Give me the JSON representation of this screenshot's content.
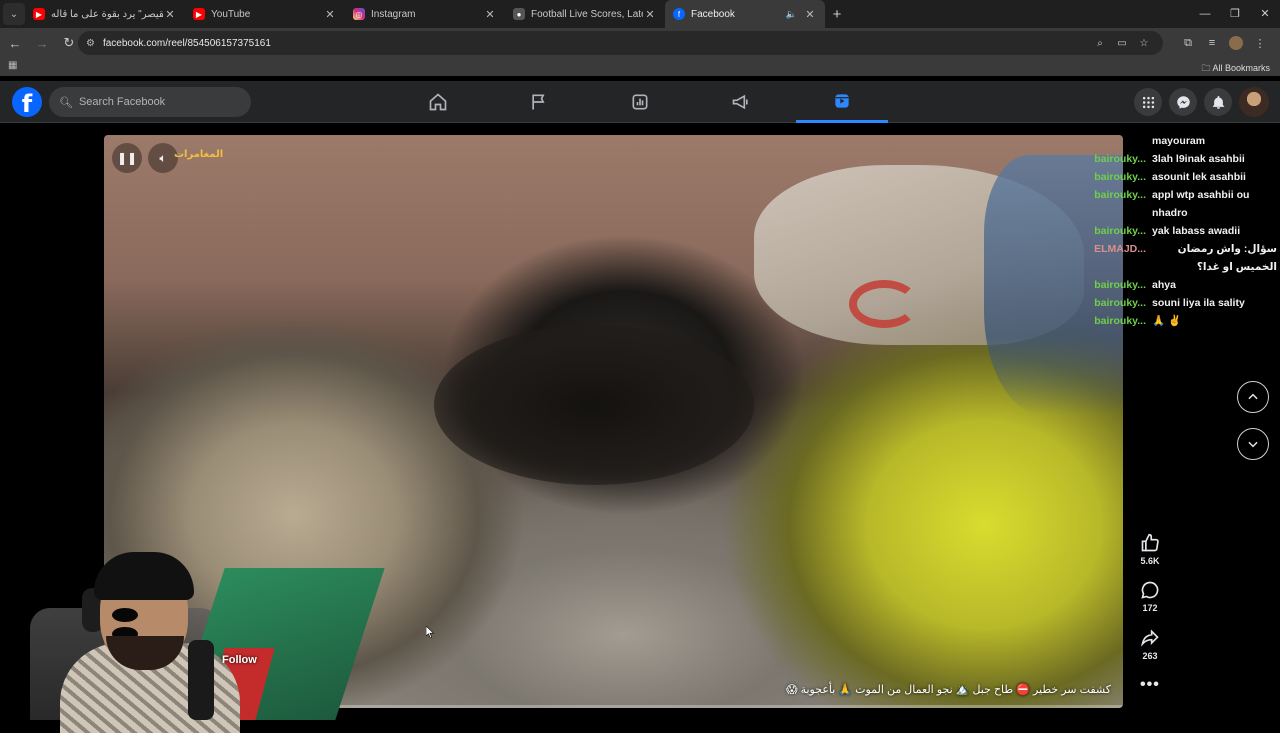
{
  "browser": {
    "tabs": [
      {
        "title": "القيصر\" يرد بقوة على ما قاله wa\"",
        "favicon": "youtube-icon",
        "color": "#ff0000"
      },
      {
        "title": "YouTube",
        "favicon": "youtube-icon",
        "color": "#ff0000"
      },
      {
        "title": "Instagram",
        "favicon": "instagram-icon",
        "color": "#d6249f"
      },
      {
        "title": "Football Live Scores, Latest Foo",
        "favicon": "generic-site-icon",
        "color": "#555555"
      },
      {
        "title": "Facebook",
        "favicon": "facebook-icon",
        "color": "#0866ff",
        "active": true
      }
    ],
    "url": "facebook.com/reel/854506157375161",
    "bookmarks_label": "All Bookmarks"
  },
  "facebook": {
    "search_placeholder": "Search Facebook",
    "brand_color": "#0866ff",
    "nav": [
      "home-icon",
      "pages-flag-icon",
      "dashboard-icon",
      "megaphone-icon",
      "reels-icon"
    ],
    "active_nav": "reels-icon"
  },
  "reel": {
    "overlay_label": "المغامرات",
    "caption": "كشفت سر خطير ⛔ طاح جبل 🏔️ نجو العمال من الموت 🙏 بأعجوبة 😱",
    "follow_label": "Follow",
    "progress": 0.08,
    "likes": "5.6K",
    "comments": "172",
    "shares": "263",
    "more_label": "•••"
  },
  "chat": {
    "first_message": "mayouram",
    "messages": [
      {
        "user": "bairouky...",
        "text": "3lah l9inak asahbii"
      },
      {
        "user": "bairouky...",
        "text": "asounit lek asahbii"
      },
      {
        "user": "bairouky...",
        "text": "appl wtp asahbii ou nhadro"
      },
      {
        "user": "bairouky...",
        "text": "yak labass awadii"
      },
      {
        "user": "ELMAJD...",
        "text": "سؤال: واش رمضان الخميس او غدا؟",
        "rtl": true,
        "alt": true
      },
      {
        "user": "bairouky...",
        "text": "ahya"
      },
      {
        "user": "bairouky...",
        "text": "souni liya ila sality"
      },
      {
        "user": "bairouky...",
        "text": "🙏 ✌️"
      }
    ]
  }
}
